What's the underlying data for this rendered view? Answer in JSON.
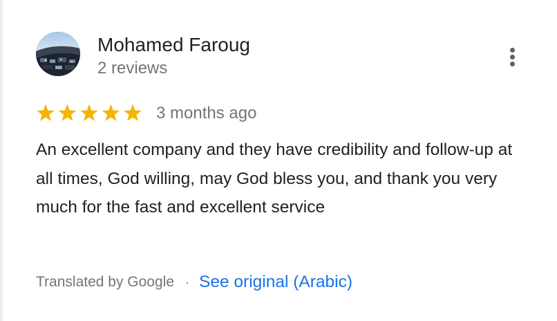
{
  "review": {
    "author_name": "Mohamed Faroug",
    "review_count": "2 reviews",
    "rating": 5,
    "rating_max": 5,
    "time_ago": "3 months ago",
    "text": "An excellent company and they have credibility and follow-up at all times, God willing, may God bless you, and thank you very much for the fast and excellent service",
    "translated_label": "Translated by Google",
    "separator": "·",
    "see_original_label": "See original (Arabic)"
  },
  "icons": {
    "star": "star-icon",
    "more": "more-vert-icon"
  },
  "colors": {
    "star": "#F4B400",
    "link": "#1A73E8",
    "primary_text": "#202124",
    "secondary_text": "#70757A"
  }
}
